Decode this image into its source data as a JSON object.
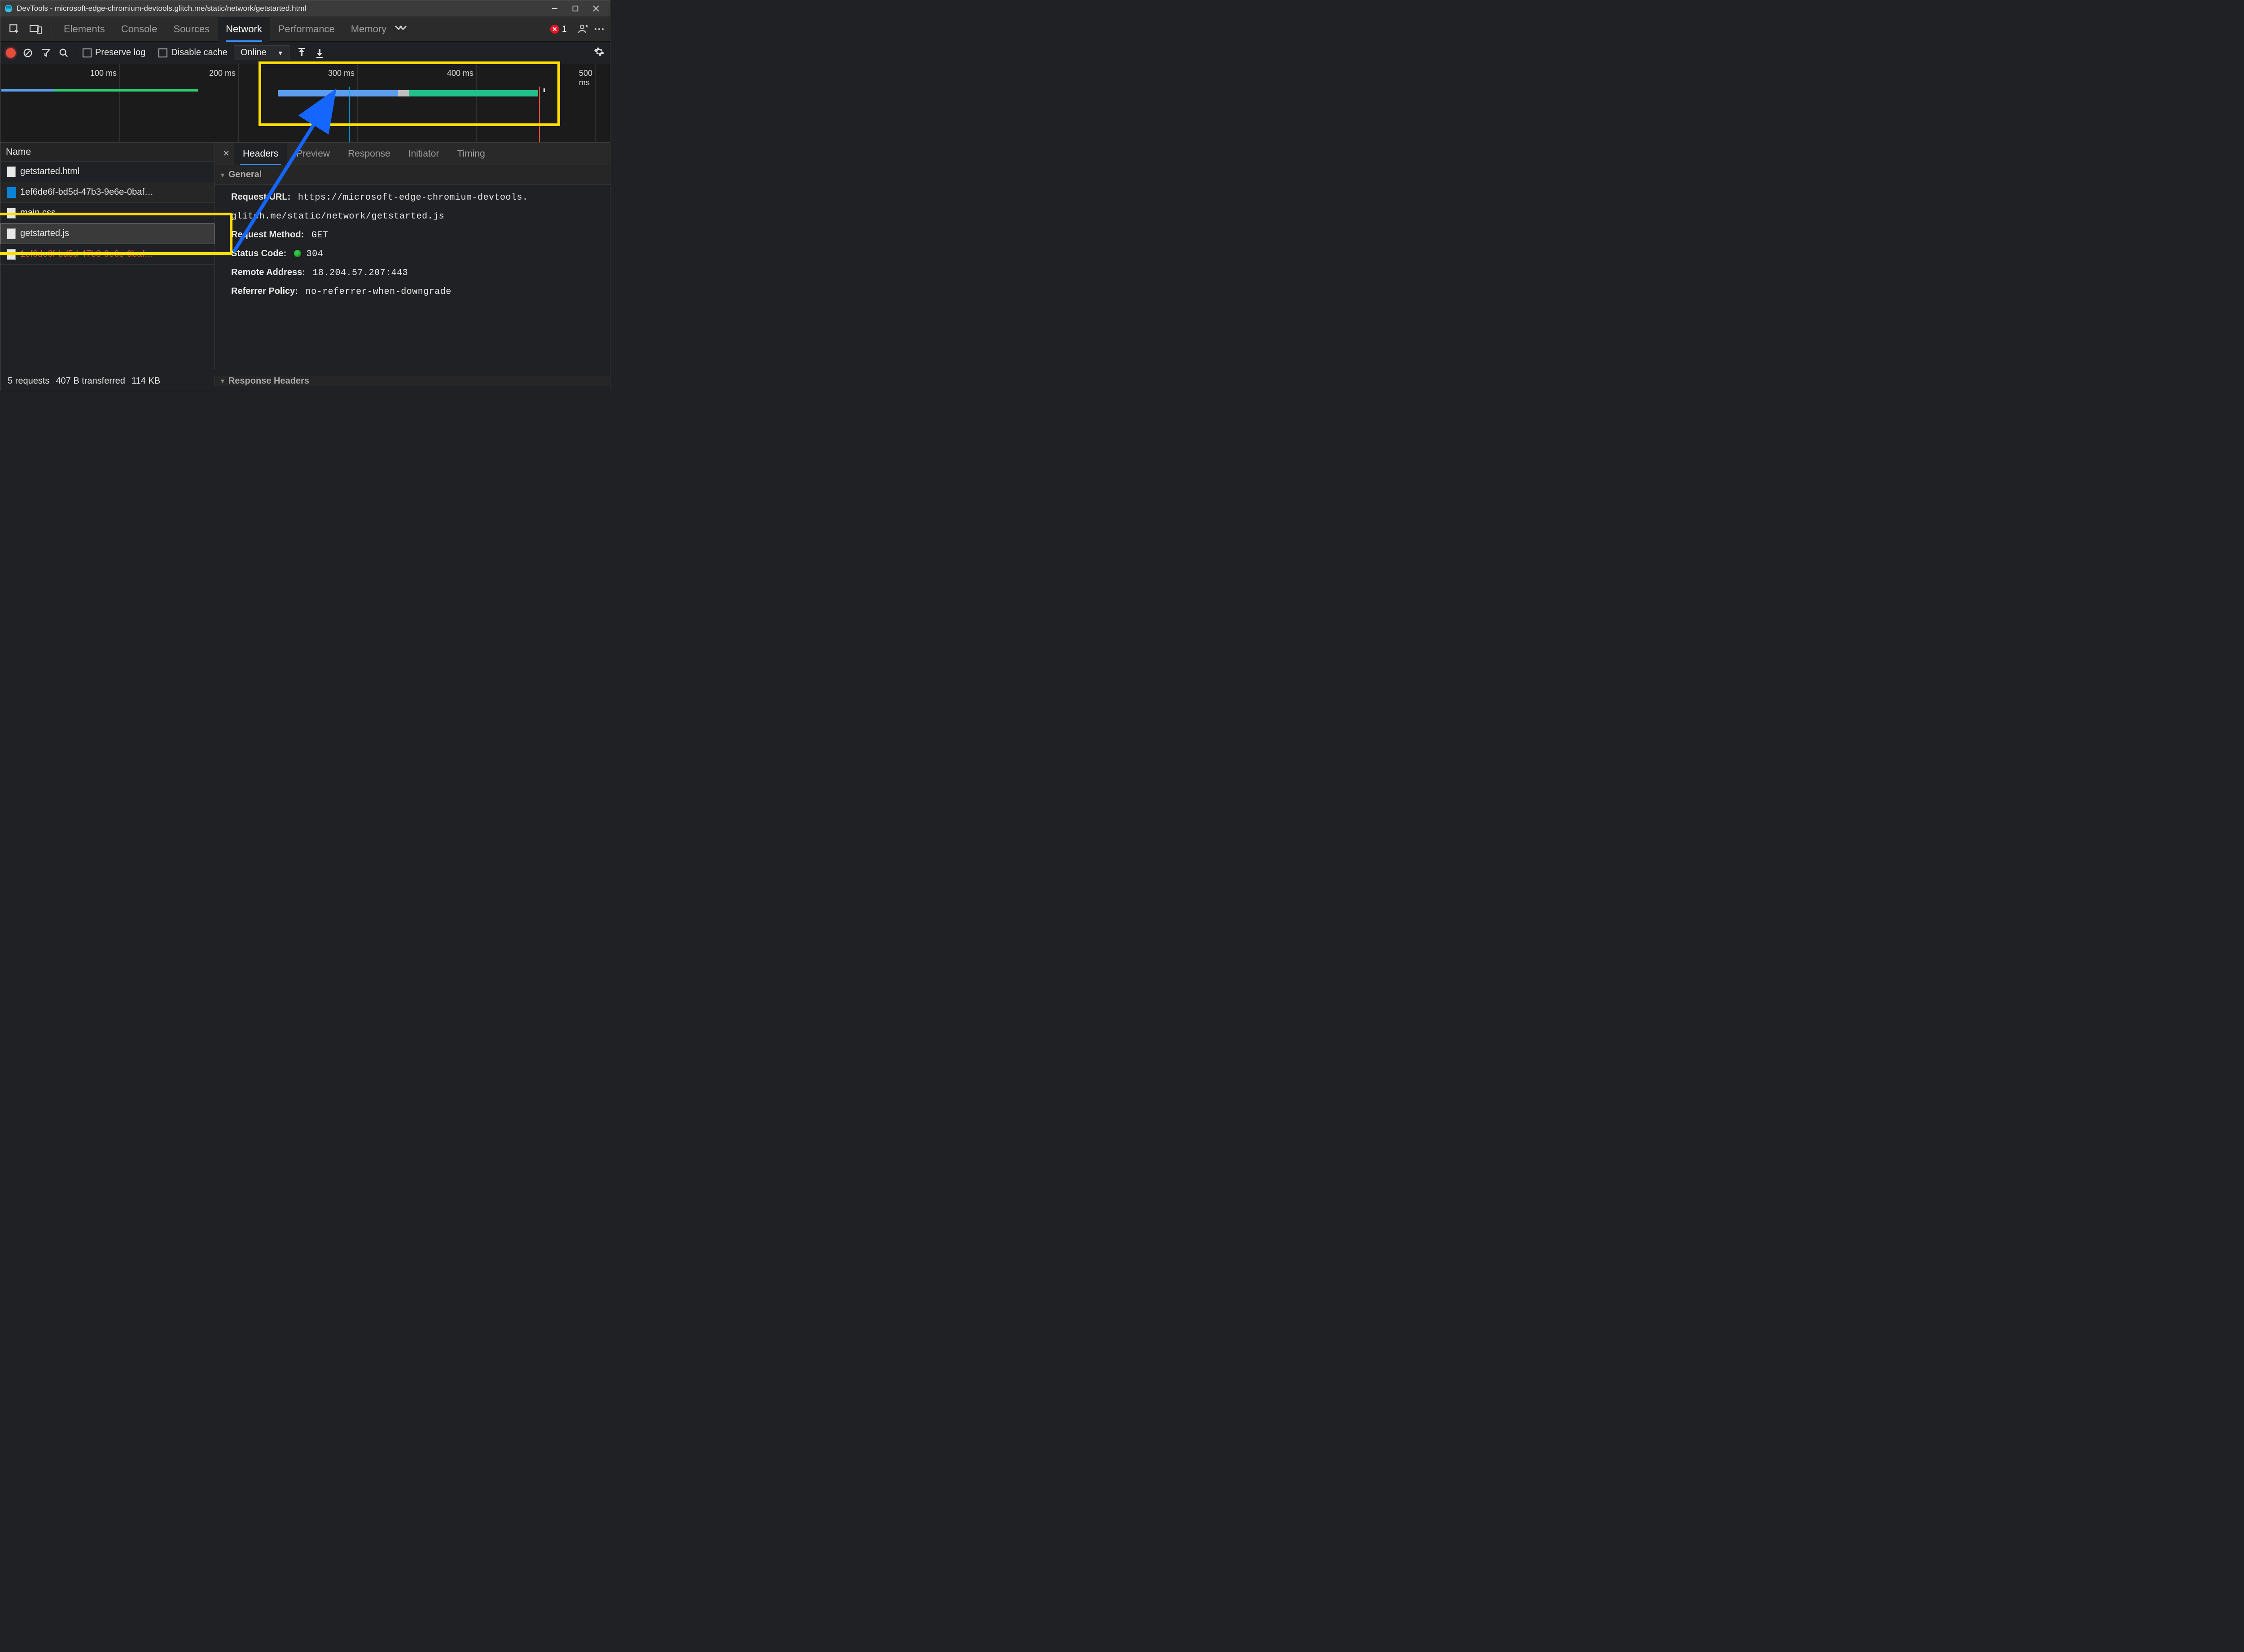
{
  "window": {
    "title": "DevTools - microsoft-edge-chromium-devtools.glitch.me/static/network/getstarted.html"
  },
  "panel_tabs": {
    "elements": "Elements",
    "console": "Console",
    "sources": "Sources",
    "network": "Network",
    "performance": "Performance",
    "memory": "Memory",
    "error_count": "1"
  },
  "net_toolbar": {
    "preserve_log": "Preserve log",
    "disable_cache": "Disable cache",
    "throttling": "Online"
  },
  "overview": {
    "ticks": {
      "t100": "100 ms",
      "t200": "200 ms",
      "t300": "300 ms",
      "t400": "400 ms",
      "t500": "500 ms"
    }
  },
  "request_list": {
    "col_name": "Name",
    "rows": {
      "r0": "getstarted.html",
      "r1": "1ef6de6f-bd5d-47b3-9e6e-0baf…",
      "r2": "main.css",
      "r3": "getstarted.js",
      "r4": "1ef6de6f-bd5d-47b3-9e6e-0baf…"
    }
  },
  "detail_tabs": {
    "headers": "Headers",
    "preview": "Preview",
    "response": "Response",
    "initiator": "Initiator",
    "timing": "Timing"
  },
  "headers": {
    "general_title": "General",
    "request_url_label": "Request URL:",
    "request_url_value_line1": "https://microsoft-edge-chromium-devtools.",
    "request_url_value_line2": "glitch.me/static/network/getstarted.js",
    "request_method_label": "Request Method:",
    "request_method_value": "GET",
    "status_code_label": "Status Code:",
    "status_code_value": "304",
    "remote_address_label": "Remote Address:",
    "remote_address_value": "18.204.57.207:443",
    "referrer_policy_label": "Referrer Policy:",
    "referrer_policy_value": "no-referrer-when-downgrade",
    "response_headers_title": "Response Headers"
  },
  "status_bar": {
    "requests": "5 requests",
    "transferred": "407 B transferred",
    "resources": "114 KB"
  }
}
